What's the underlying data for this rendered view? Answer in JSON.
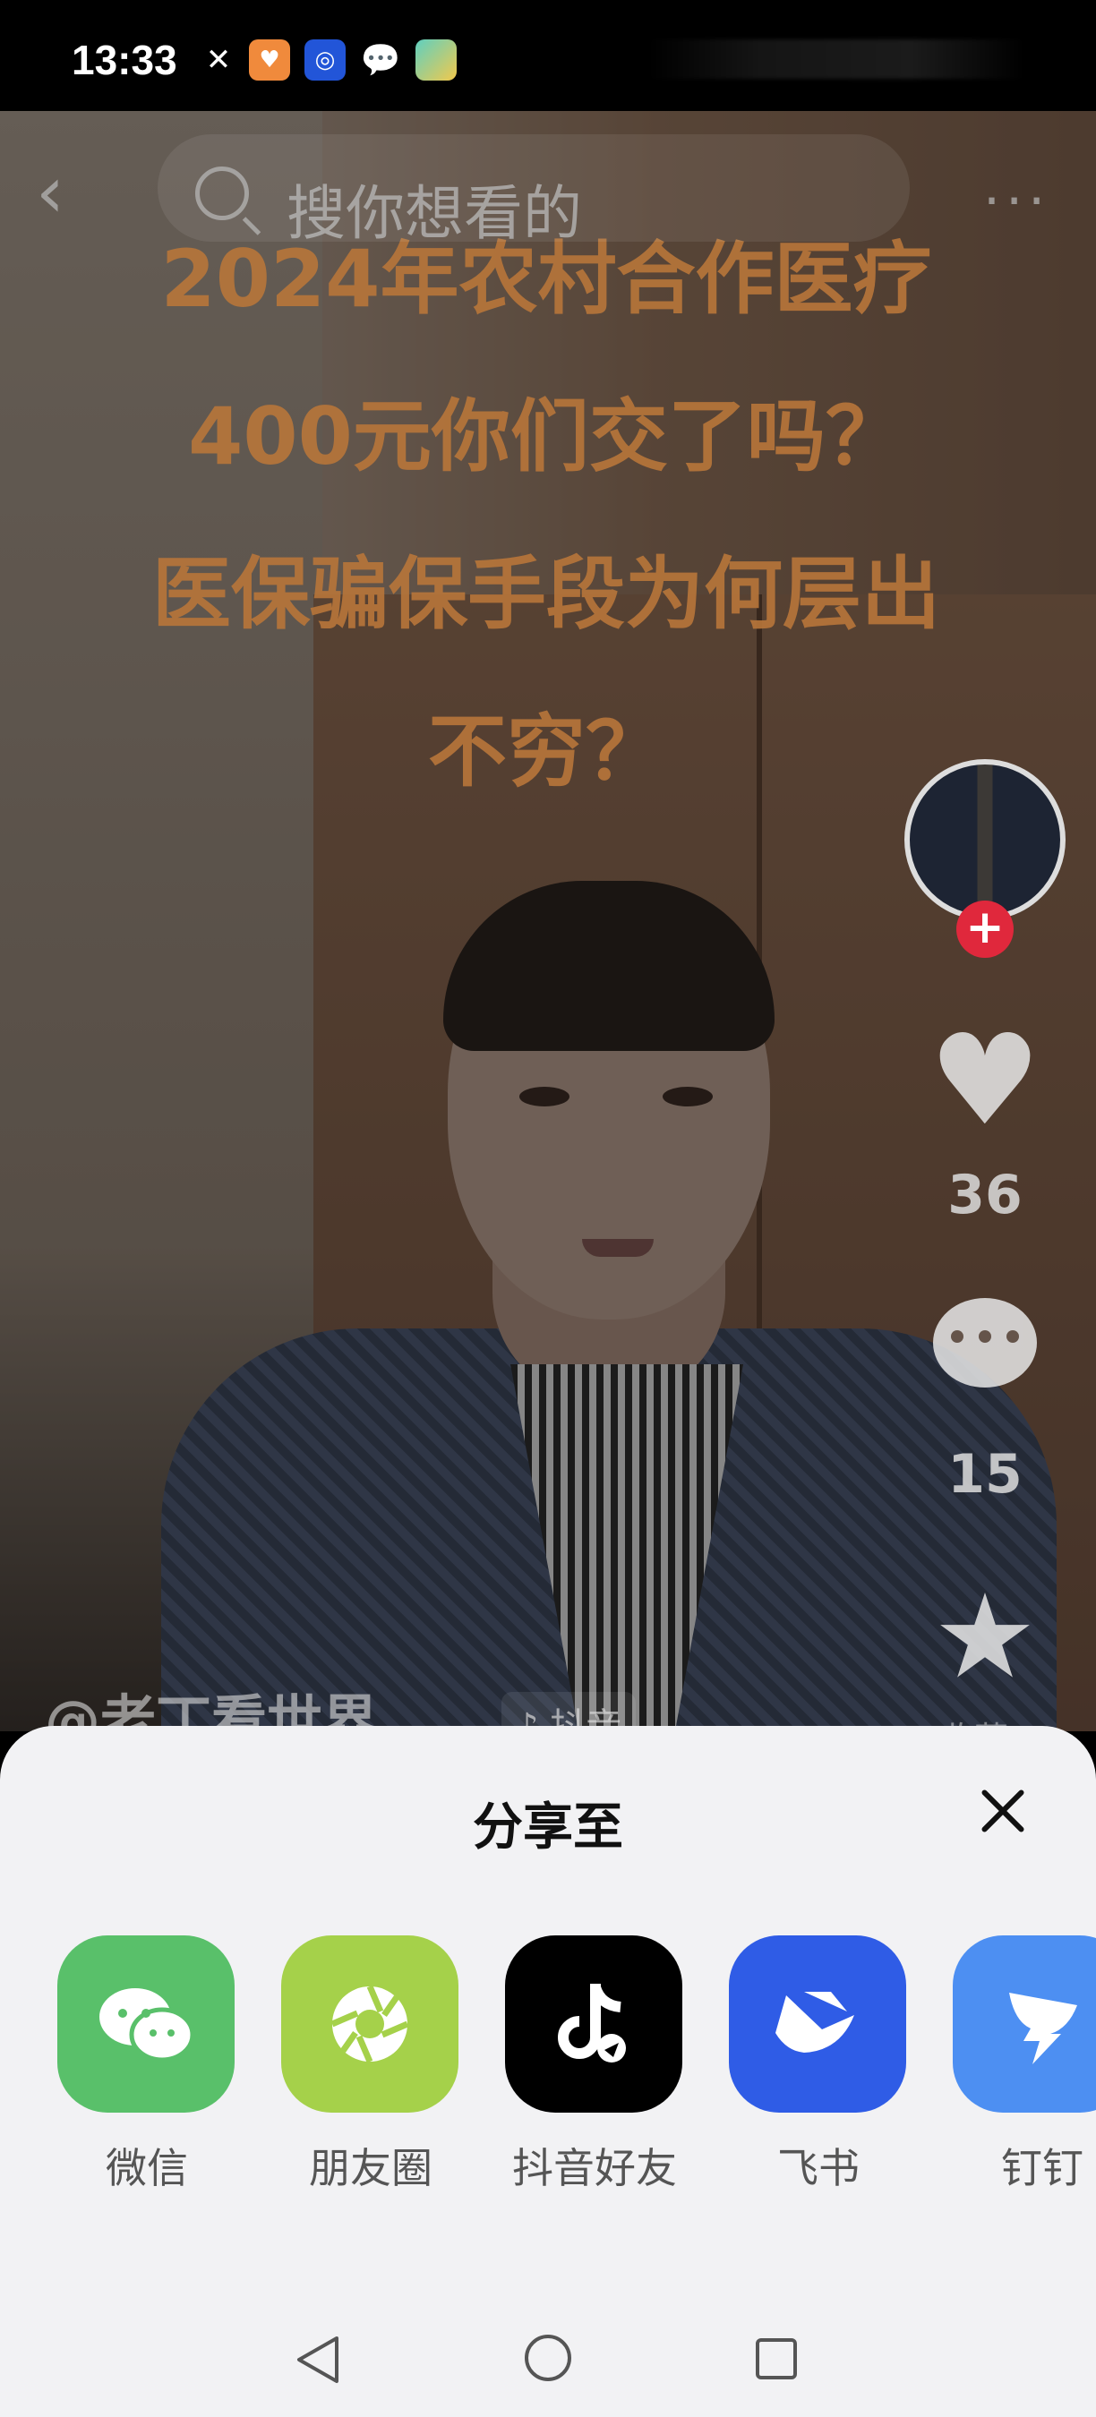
{
  "status_bar": {
    "time": "13:33",
    "icons": [
      "missed-call-icon",
      "health-app-icon",
      "browser-app-icon",
      "wechat-icon",
      "fingerprint-app-icon"
    ]
  },
  "video": {
    "caption_lines": [
      "2024年农村合作医疗",
      "400元你们交了吗？",
      "医保骗保手段为何层出",
      "不穷？"
    ],
    "search_placeholder": "搜你想看的",
    "like_count": "36",
    "comment_count": "15",
    "author": "@老丁看世界",
    "music_tag": "♪ 抖音",
    "fav_label": "收藏",
    "follow_symbol": "+"
  },
  "share_sheet": {
    "title": "分享至",
    "targets": [
      {
        "label": "微信",
        "icon": "wechat-icon",
        "color": "#59c06a"
      },
      {
        "label": "朋友圈",
        "icon": "moments-icon",
        "color": "#a5d14a"
      },
      {
        "label": "抖音好友",
        "icon": "douyin-icon",
        "color": "#000000"
      },
      {
        "label": "飞书",
        "icon": "feishu-icon",
        "color": "#2f5ce6"
      },
      {
        "label": "钉钉",
        "icon": "dingtalk-icon",
        "color": "#4d8ff2"
      }
    ]
  },
  "nav_bar": {
    "buttons": [
      "back",
      "home",
      "recents"
    ]
  }
}
